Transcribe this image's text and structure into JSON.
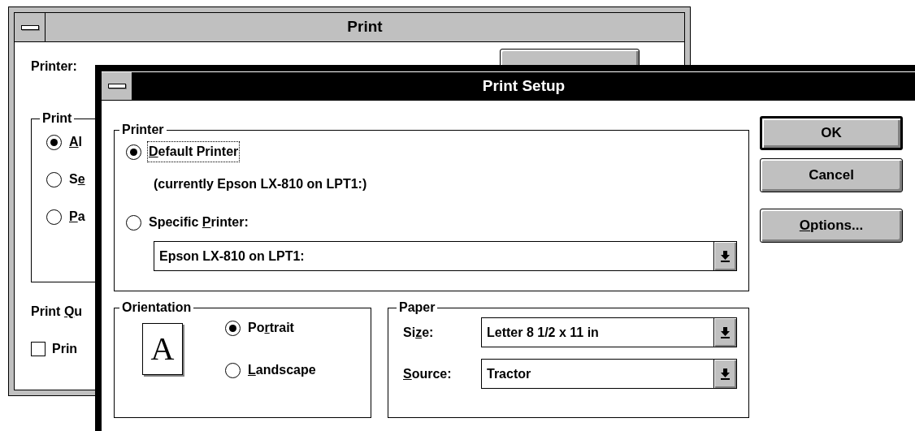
{
  "background_window": {
    "title": "Print",
    "active": false,
    "printer_label": "Printer:",
    "range_group": "Print",
    "range_options": [
      {
        "key": "A",
        "post": "l",
        "selected": true
      },
      {
        "pre": "S",
        "key": "e",
        "selected": false
      },
      {
        "key": "P",
        "post": "a",
        "selected": false
      }
    ],
    "quality_label": {
      "pre": "Print ",
      "key": "Q",
      "post": "u"
    },
    "collate": {
      "label": "Prin",
      "checked": false
    }
  },
  "dialog": {
    "title": "Print Setup",
    "active": true,
    "printer_group": {
      "title": "Printer",
      "options": [
        {
          "key": "D",
          "post": "efault Printer",
          "selected": true,
          "focused": true
        },
        {
          "pre": "Specific ",
          "key": "P",
          "post": "rinter:",
          "selected": false,
          "focused": false
        }
      ],
      "default_note": "(currently Epson LX-810 on LPT1:)",
      "specific_value": "Epson LX-810 on LPT1:"
    },
    "orientation_group": {
      "title": "Orientation",
      "page_icon_letter": "A",
      "options": [
        {
          "pre": "Po",
          "key": "r",
          "post": "trait",
          "selected": true
        },
        {
          "key": "L",
          "post": "andscape",
          "selected": false
        }
      ]
    },
    "paper_group": {
      "title": "Paper",
      "fields": [
        {
          "pre": "Si",
          "key": "z",
          "post": "e:",
          "value": "Letter 8 1/2 x 11 in"
        },
        {
          "key": "S",
          "post": "ource:",
          "value": "Tractor"
        }
      ]
    },
    "buttons": [
      {
        "pre": "OK",
        "default": true
      },
      {
        "pre": "Cancel",
        "default": false
      },
      {
        "key": "O",
        "post": "ptions...",
        "default": false
      }
    ]
  }
}
